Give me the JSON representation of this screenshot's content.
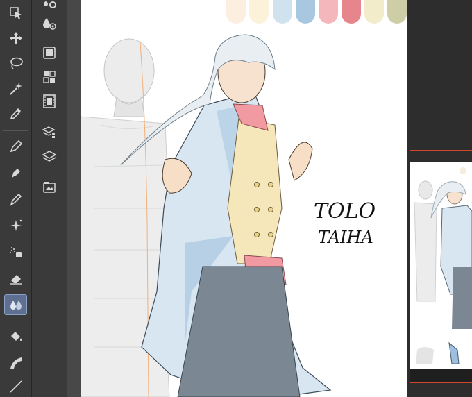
{
  "app": {
    "accent_color": "#5f6f8f",
    "highlight_color": "#d2452a"
  },
  "toolbar": {
    "tools": [
      {
        "name": "object-select",
        "active": false
      },
      {
        "name": "move",
        "active": false
      },
      {
        "name": "lasso-selection",
        "active": false
      },
      {
        "name": "magic-wand",
        "active": false
      },
      {
        "name": "eyedropper",
        "active": false
      },
      {
        "name": "pen",
        "active": false
      },
      {
        "name": "pencil",
        "active": false
      },
      {
        "name": "brush",
        "active": false
      },
      {
        "name": "decoration",
        "active": false
      },
      {
        "name": "airbrush",
        "active": false
      },
      {
        "name": "eraser",
        "active": false
      },
      {
        "name": "blend",
        "active": true
      },
      {
        "name": "fill",
        "active": false
      },
      {
        "name": "gradient",
        "active": false
      },
      {
        "name": "line",
        "active": false
      }
    ]
  },
  "command_bar": {
    "commands": [
      "material-settings",
      "color-mixing",
      "layer-mask",
      "tone",
      "animation",
      "layer-property",
      "layers",
      "sub-view"
    ]
  },
  "canvas": {
    "palette": [
      "#fcefe0",
      "#fbf2d9",
      "#cfe2ee",
      "#a8c8e1",
      "#f4b7bb",
      "#e6868c",
      "#f3ecca",
      "#cdcda6"
    ],
    "signature_lines": [
      "TOLO",
      "TAIHA"
    ]
  },
  "navigator": {
    "label": ""
  }
}
